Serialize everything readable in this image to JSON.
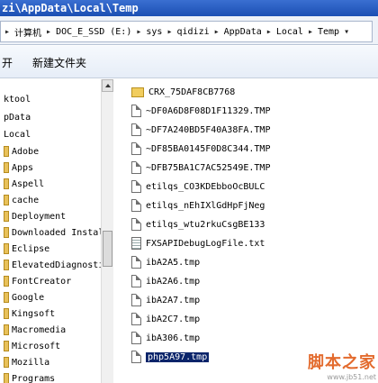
{
  "window": {
    "title": "zi\\AppData\\Local\\Temp"
  },
  "breadcrumb": [
    "计算机",
    "DOC_E_SSD (E:)",
    "sys",
    "qidizi",
    "AppData",
    "Local",
    "Temp"
  ],
  "breadcrumb_separator": "▸",
  "breadcrumb_dropdown": "▾",
  "toolbar": {
    "open_label": "开",
    "new_folder_label": "新建文件夹"
  },
  "nav": {
    "items": [
      "ktool",
      "pData",
      "Local",
      "Adobe",
      "Apps",
      "Aspell",
      "cache",
      "Deployment",
      "Downloaded Installations",
      "Eclipse",
      "ElevatedDiagnostics",
      "FontCreator",
      "Google",
      "Kingsoft",
      "Macromedia",
      "Microsoft",
      "Mozilla",
      "Programs"
    ]
  },
  "files": [
    {
      "name": "CRX_75DAF8CB7768",
      "icon": "folder-icon"
    },
    {
      "name": "~DF0A6D8F08D1F11329.TMP",
      "icon": "file-icon"
    },
    {
      "name": "~DF7A240BD5F40A38FA.TMP",
      "icon": "file-icon"
    },
    {
      "name": "~DF85BA0145F0D8C344.TMP",
      "icon": "file-icon"
    },
    {
      "name": "~DFB75BA1C7AC52549E.TMP",
      "icon": "file-icon"
    },
    {
      "name": "etilqs_CO3KDEbboOcBULC",
      "icon": "file-icon"
    },
    {
      "name": "etilqs_nEhIXlGdHpFjNeg",
      "icon": "file-icon"
    },
    {
      "name": "etilqs_wtu2rkuCsgBE133",
      "icon": "file-icon"
    },
    {
      "name": "FXSAPIDebugLogFile.txt",
      "icon": "text-file-icon"
    },
    {
      "name": "ibA2A5.tmp",
      "icon": "file-icon"
    },
    {
      "name": "ibA2A6.tmp",
      "icon": "file-icon"
    },
    {
      "name": "ibA2A7.tmp",
      "icon": "file-icon"
    },
    {
      "name": "ibA2C7.tmp",
      "icon": "file-icon"
    },
    {
      "name": "ibA306.tmp",
      "icon": "file-icon"
    },
    {
      "name": "php5A97.tmp",
      "icon": "file-icon",
      "selected": true
    }
  ],
  "watermark": {
    "title": "脚本之家",
    "url": "www.jb51.net"
  }
}
